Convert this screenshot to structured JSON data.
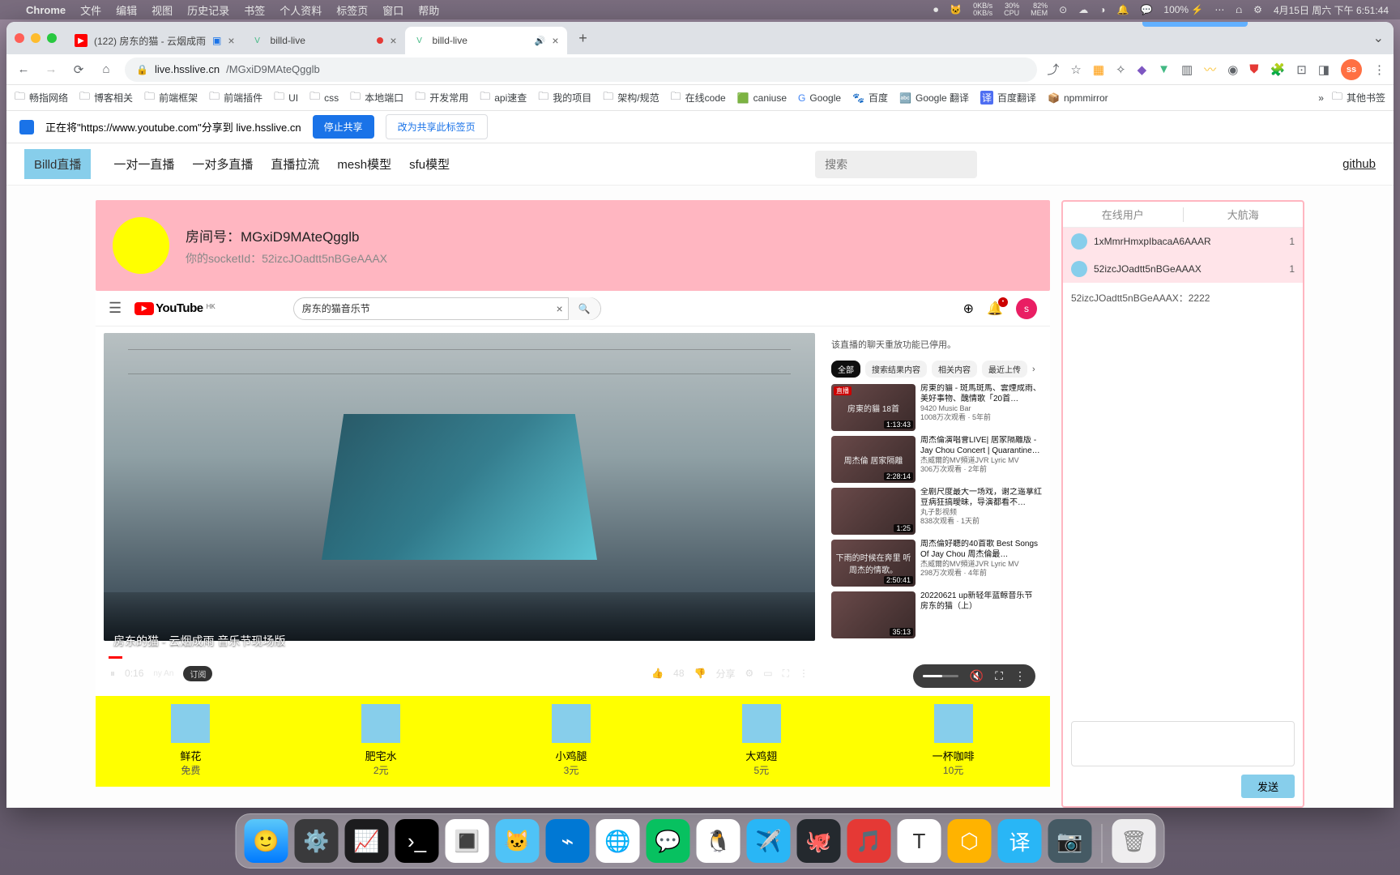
{
  "menubar": {
    "app": "Chrome",
    "items": [
      "文件",
      "编辑",
      "视图",
      "历史记录",
      "书签",
      "个人资料",
      "标签页",
      "窗口",
      "帮助"
    ],
    "net": {
      "up": "0KB/s",
      "down": "0KB/s"
    },
    "cpu": {
      "val": "30%",
      "lbl": "CPU"
    },
    "mem": {
      "val": "82%",
      "lbl": "MEM"
    },
    "battery": "100% ⚡",
    "datetime": "4月15日 周六 下午 6:51:44"
  },
  "tabs": [
    {
      "favicon": "▶",
      "favbg": "#ff0000",
      "title": "(122) 房东的猫 - 云烟成雨",
      "closable": true,
      "extra": "screen"
    },
    {
      "favicon": "V",
      "favbg": "#42b883",
      "title": "billd-live",
      "closable": true,
      "rec": true
    },
    {
      "favicon": "V",
      "favbg": "#42b883",
      "title": "billd-live",
      "closable": true,
      "audio": true
    }
  ],
  "address": {
    "host": "live.hsslive.cn",
    "path": "/MGxiD9MAteQgglb"
  },
  "bookmarks": [
    "畅指网络",
    "博客相关",
    "前端框架",
    "前端插件",
    "UI",
    "css",
    "本地端口",
    "开发常用",
    "api速查",
    "我的项目",
    "架构/规范",
    "在线code"
  ],
  "bookmarks_ico": [
    {
      "label": "caniuse"
    },
    {
      "label": "Google"
    },
    {
      "label": "百度"
    },
    {
      "label": "Google 翻译"
    },
    {
      "label": "百度翻译"
    },
    {
      "label": "npmmirror"
    }
  ],
  "bookmarks_more": "»",
  "bookmarks_other": "其他书签",
  "share": {
    "text": "正在将\"https://www.youtube.com\"分享到 live.hsslive.cn",
    "stop": "停止共享",
    "change": "改为共享此标签页"
  },
  "site": {
    "logo": "Billd直播",
    "nav": [
      "一对一直播",
      "一对多直播",
      "直播拉流",
      "mesh模型",
      "sfu模型"
    ],
    "search_ph": "搜索",
    "github": "github"
  },
  "room": {
    "title_label": "房间号：",
    "id": "MGxiD9MAteQgglb",
    "sock_label": "你的socketId：",
    "sock": "52izcJOadtt5nBGeAAAX"
  },
  "yt": {
    "search": "房东的猫音乐节",
    "chatmsg": "该直播的聊天重放功能已停用。",
    "chips": [
      "全部",
      "搜索结果内容",
      "相关内容",
      "最近上传"
    ],
    "video_title": "房东的猫 - 云烟成雨 音乐节现场版",
    "time": "0:16",
    "likes": "48",
    "share": "分享",
    "recs": [
      {
        "title": "房東的貓 - 斑馬斑馬、雲煙成雨、美好事物、醜情歌「20首…",
        "dur": "1:13:43",
        "ch": "9420 Music Bar",
        "meta": "1008万次观看 · 5年前",
        "thumb_label": "房東的貓 18首",
        "live": true
      },
      {
        "title": "周杰倫演唱會LIVE| 居家隔離版 - Jay Chou Concert | Quarantine…",
        "dur": "2:28:14",
        "ch": "杰威爾的MV頻道JVR Lyric MV",
        "meta": "306万次观看 · 2年前",
        "thumb_label": "周杰倫 居家隔離"
      },
      {
        "title": "全剧尺度最大一场戏，谢之遥拿红豆病狂搞曖昧，导演都看不…",
        "dur": "1:25",
        "ch": "丸子影视频",
        "meta": "838次观看 · 1天前",
        "thumb_label": ""
      },
      {
        "title": "周杰倫好聽的40首歌 Best Songs Of Jay Chou 周杰倫最…",
        "dur": "2:50:41",
        "ch": "杰威爾的MV頻道JVR Lyric MV",
        "meta": "298万次观看 · 4年前",
        "thumb_label": "下雨的时候在奔里 听周杰的情歌。"
      },
      {
        "title": "20220621 up新轻年蓝鲸音乐节 房东的猫（上）",
        "dur": "35:13",
        "ch": "",
        "meta": "",
        "thumb_label": ""
      }
    ]
  },
  "gifts": [
    {
      "name": "鲜花",
      "price": "免费"
    },
    {
      "name": "肥宅水",
      "price": "2元"
    },
    {
      "name": "小鸡腿",
      "price": "3元"
    },
    {
      "name": "大鸡翅",
      "price": "5元"
    },
    {
      "name": "一杯咖啡",
      "price": "10元"
    }
  ],
  "chat": {
    "tab1": "在线用户",
    "tab2": "大航海",
    "users": [
      {
        "id": "1xMmrHmxpIbacaA6AAAR",
        "n": "1"
      },
      {
        "id": "52izcJOadtt5nBGeAAAX",
        "n": "1"
      }
    ],
    "msg_from": "52izcJOadtt5nBGeAAAX：",
    "msg_body": "2222",
    "send": "发送"
  }
}
